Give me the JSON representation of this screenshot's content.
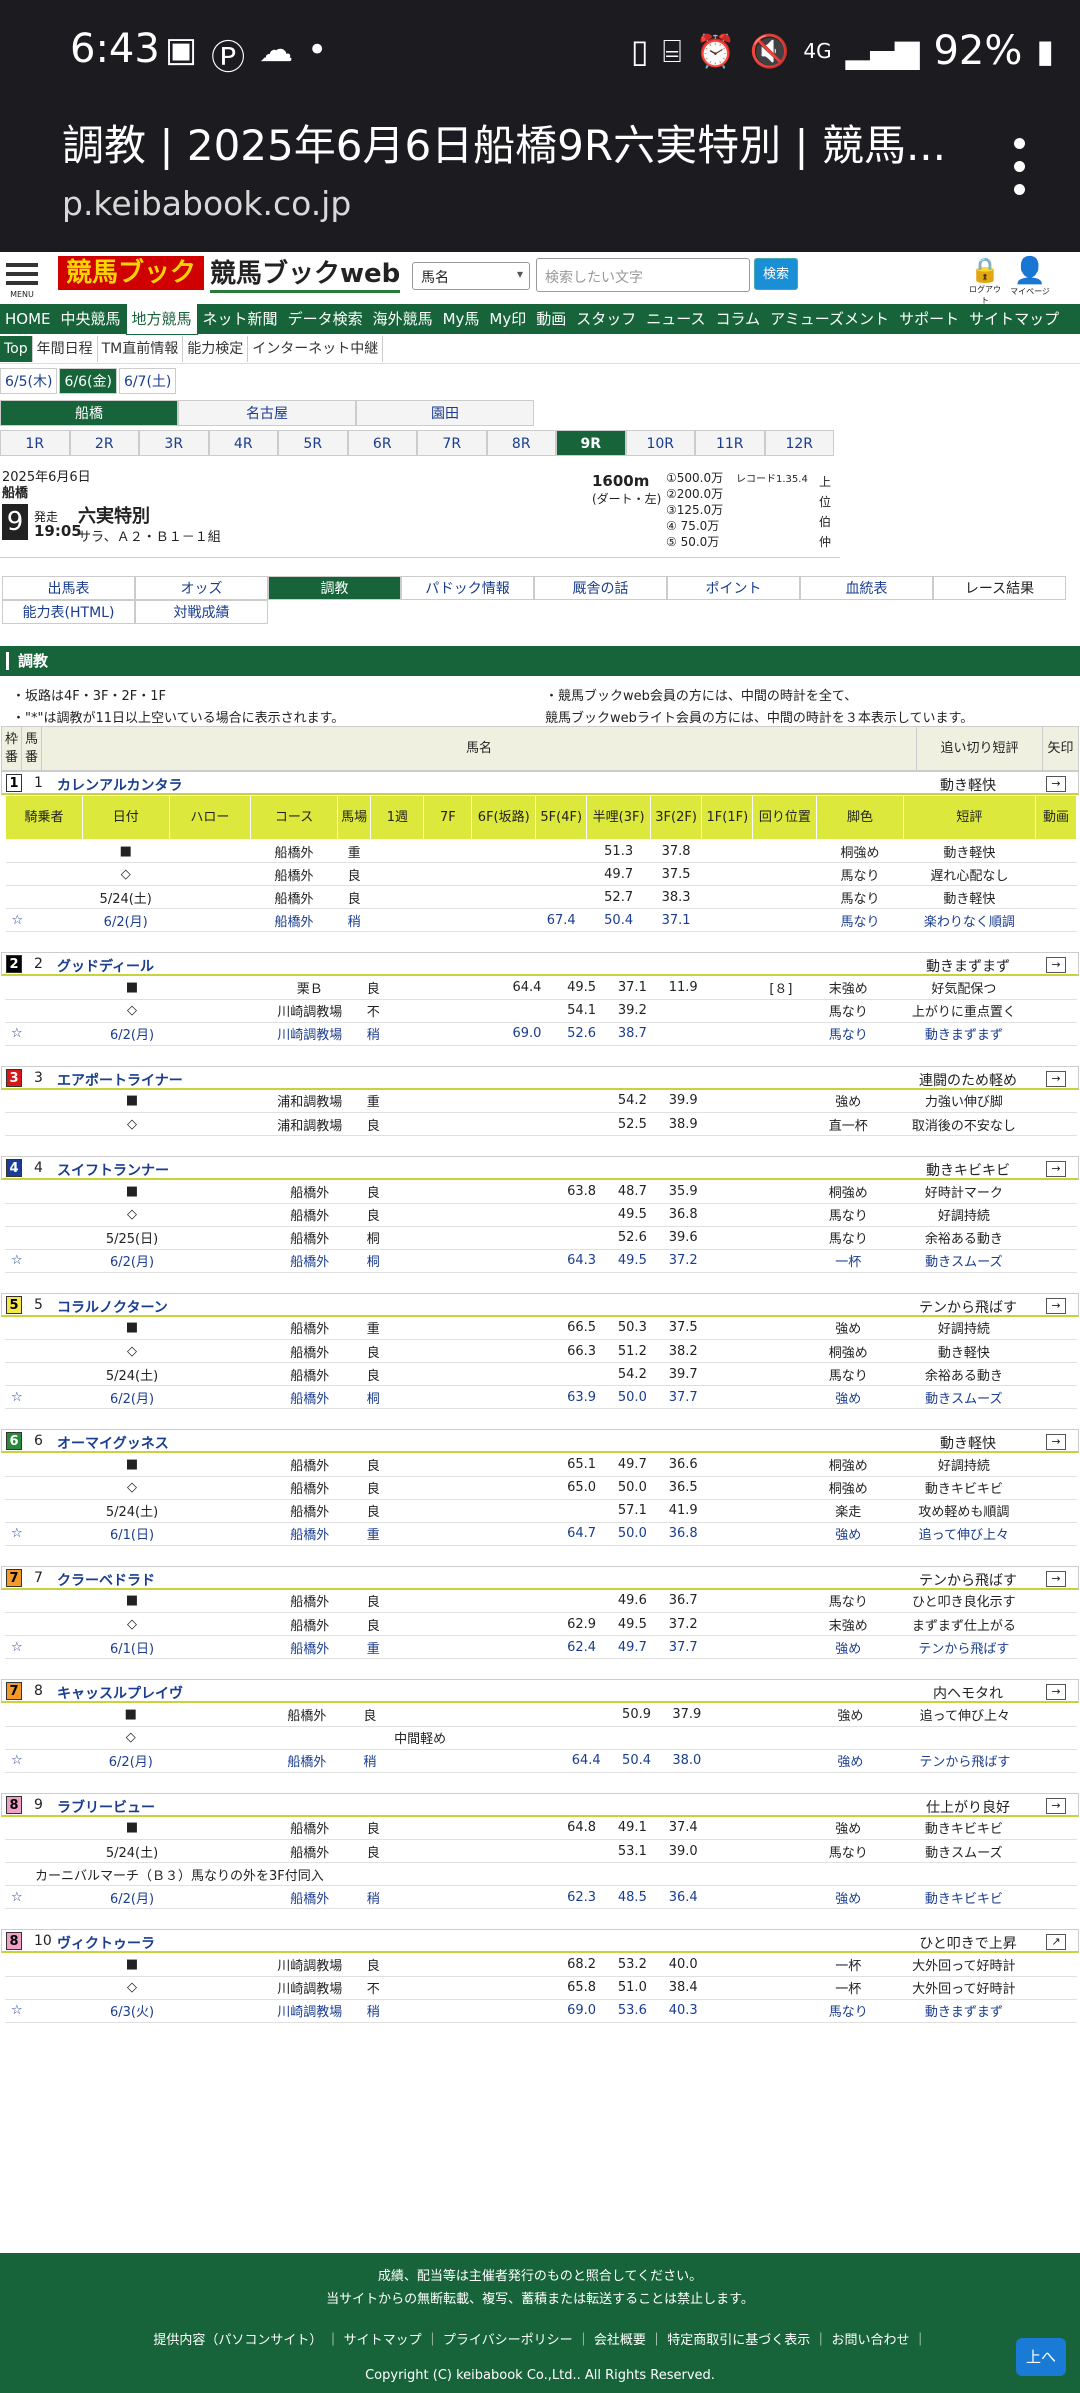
{
  "statusbar": {
    "time": "6:43",
    "battery": "92%",
    "network": "4G"
  },
  "browser": {
    "page_title": "調教 | 2025年6月6日船橋9R六実特別 | 競馬...",
    "url": "p.keibabook.co.jp"
  },
  "header": {
    "menu_label": "MENU",
    "logo_mark": "競馬ブック",
    "logo_text": "競馬ブックweb",
    "select_value": "馬名",
    "search_placeholder": "検索したい文字",
    "search_button": "検索",
    "logout_label": "ログアウト",
    "mypage_label": "マイページ"
  },
  "gnav": [
    "HOME",
    "中央競馬",
    "地方競馬",
    "ネット新聞",
    "データ検索",
    "海外競馬",
    "My馬",
    "My印",
    "動画",
    "スタッフ",
    "ニュース",
    "コラム",
    "アミューズメント",
    "サポート",
    "サイトマップ"
  ],
  "subnav": [
    "Top",
    "年間日程",
    "TM直前情報",
    "能力検定",
    "インターネット中継"
  ],
  "dates": [
    "6/5(木)",
    "6/6(金)",
    "6/7(土)"
  ],
  "venues": [
    "船橋",
    "名古屋",
    "園田"
  ],
  "races": [
    "1R",
    "2R",
    "3R",
    "4R",
    "5R",
    "6R",
    "7R",
    "8R",
    "9R",
    "10R",
    "11R",
    "12R"
  ],
  "race": {
    "date": "2025年6月6日",
    "venue": "船橋",
    "number": "9",
    "start_label": "発走",
    "start_time": "19:05",
    "name": "六実特別",
    "conditions": "サラ、Ａ２・Ｂ１－１組",
    "distance": "1600m",
    "track": "(ダート・左)",
    "record": "レコード1.35.4",
    "prizes": [
      "①500.0万",
      "②200.0万",
      "③125.0万",
      "④ 75.0万",
      "⑤ 50.0万"
    ],
    "tier": [
      "上",
      "位",
      "伯",
      "仲"
    ]
  },
  "tabs": [
    "出馬表",
    "オッズ",
    "調教",
    "パドック情報",
    "厩舎の話",
    "ポイント",
    "血統表",
    "レース結果",
    "能力表(HTML)",
    "対戦成績"
  ],
  "section_title": "調教",
  "notes_left": [
    "・坂路は4F・3F・2F・1F",
    "・\"*\"は調教が11日以上空いている場合に表示されます。"
  ],
  "notes_right": [
    "・競馬ブックweb会員の方には、中間の時計を全て、",
    "競馬ブックwebライト会員の方には、中間の時計を３本表示しています。"
  ],
  "page_header": {
    "waku": "枠番",
    "uma": "馬番",
    "name": "馬名",
    "short": "追い切り短評",
    "arrow": "矢印"
  },
  "train_header": [
    "騎乗者",
    "日付",
    "ハロー",
    "コース",
    "馬場",
    "1週",
    "7F",
    "6F(坂路)",
    "5F(4F)",
    "半哩(3F)",
    "3F(2F)",
    "1F(1F)",
    "回り位置",
    "脚色",
    "短評",
    "動画"
  ],
  "horses": [
    {
      "waku": "1",
      "uma": "1",
      "name": "カレンアルカンタラ",
      "short": "動き軽快",
      "color": "#ffffff",
      "rows": [
        [
          "",
          "■",
          "",
          "船橋外",
          "重",
          "",
          "",
          "",
          "",
          "51.3",
          "37.8",
          "",
          "",
          "桐強め",
          "動き軽快",
          ""
        ],
        [
          "",
          "◇",
          "",
          "船橋外",
          "良",
          "",
          "",
          "",
          "",
          "49.7",
          "37.5",
          "",
          "",
          "馬なり",
          "遅れ心配なし",
          ""
        ],
        [
          "",
          "5/24(土)",
          "",
          "船橋外",
          "良",
          "",
          "",
          "",
          "",
          "52.7",
          "38.3",
          "",
          "",
          "馬なり",
          "動き軽快",
          ""
        ],
        [
          "☆",
          "6/2(月)",
          "",
          "船橋外",
          "稍",
          "",
          "",
          "",
          "67.4",
          "50.4",
          "37.1",
          "",
          "",
          "馬なり",
          "楽わりなく順調",
          ""
        ]
      ]
    },
    {
      "waku": "2",
      "uma": "2",
      "name": "グッドディール",
      "short": "動きまずまず",
      "color": "#000000",
      "rows": [
        [
          "",
          "■",
          "",
          "栗Ｂ",
          "良",
          "",
          "",
          "64.4",
          "49.5",
          "37.1",
          "11.9",
          "",
          "[８]",
          "末強め",
          "好気配保つ",
          ""
        ],
        [
          "",
          "◇",
          "",
          "川崎調教場",
          "不",
          "",
          "",
          "",
          "54.1",
          "39.2",
          "",
          "",
          "",
          "馬なり",
          "上がりに重点置く",
          ""
        ],
        [
          "☆",
          "6/2(月)",
          "",
          "川崎調教場",
          "稍",
          "",
          "",
          "69.0",
          "52.6",
          "38.7",
          "",
          "",
          "",
          "馬なり",
          "動きまずまず",
          ""
        ]
      ]
    },
    {
      "waku": "3",
      "uma": "3",
      "name": "エアポートライナー",
      "short": "連闘のため軽め",
      "color": "#d81818",
      "rows": [
        [
          "",
          "■",
          "",
          "浦和調教場",
          "重",
          "",
          "",
          "",
          "",
          "54.2",
          "39.9",
          "",
          "",
          "強め",
          "力強い伸び脚",
          ""
        ],
        [
          "",
          "◇",
          "",
          "浦和調教場",
          "良",
          "",
          "",
          "",
          "",
          "52.5",
          "38.9",
          "",
          "",
          "直一杯",
          "取消後の不安なし",
          ""
        ]
      ]
    },
    {
      "waku": "4",
      "uma": "4",
      "name": "スイフトランナー",
      "short": "動きキビキビ",
      "color": "#1a3d9a",
      "rows": [
        [
          "",
          "■",
          "",
          "船橋外",
          "良",
          "",
          "",
          "",
          "63.8",
          "48.7",
          "35.9",
          "",
          "",
          "桐強め",
          "好時計マーク",
          ""
        ],
        [
          "",
          "◇",
          "",
          "船橋外",
          "良",
          "",
          "",
          "",
          "",
          "49.5",
          "36.8",
          "",
          "",
          "馬なり",
          "好調持続",
          ""
        ],
        [
          "",
          "5/25(日)",
          "",
          "船橋外",
          "桐",
          "",
          "",
          "",
          "",
          "52.6",
          "39.6",
          "",
          "",
          "馬なり",
          "余裕ある動き",
          ""
        ],
        [
          "☆",
          "6/2(月)",
          "",
          "船橋外",
          "桐",
          "",
          "",
          "",
          "64.3",
          "49.5",
          "37.2",
          "",
          "",
          "一杯",
          "動きスムーズ",
          ""
        ]
      ]
    },
    {
      "waku": "5",
      "uma": "5",
      "name": "コラルノクターン",
      "short": "テンから飛ばす",
      "color": "#f6e84a",
      "rows": [
        [
          "",
          "■",
          "",
          "船橋外",
          "重",
          "",
          "",
          "",
          "66.5",
          "50.3",
          "37.5",
          "",
          "",
          "強め",
          "好調持続",
          ""
        ],
        [
          "",
          "◇",
          "",
          "船橋外",
          "良",
          "",
          "",
          "",
          "66.3",
          "51.2",
          "38.2",
          "",
          "",
          "桐強め",
          "動き軽快",
          ""
        ],
        [
          "",
          "5/24(土)",
          "",
          "船橋外",
          "良",
          "",
          "",
          "",
          "",
          "54.2",
          "39.7",
          "",
          "",
          "馬なり",
          "余裕ある動き",
          ""
        ],
        [
          "☆",
          "6/2(月)",
          "",
          "船橋外",
          "桐",
          "",
          "",
          "",
          "63.9",
          "50.0",
          "37.7",
          "",
          "",
          "強め",
          "動きスムーズ",
          ""
        ]
      ]
    },
    {
      "waku": "6",
      "uma": "6",
      "name": "オーマイグッネス",
      "short": "動き軽快",
      "color": "#2a8a3a",
      "rows": [
        [
          "",
          "■",
          "",
          "船橋外",
          "良",
          "",
          "",
          "",
          "65.1",
          "49.7",
          "36.6",
          "",
          "",
          "桐強め",
          "好調持続",
          ""
        ],
        [
          "",
          "◇",
          "",
          "船橋外",
          "良",
          "",
          "",
          "",
          "65.0",
          "50.0",
          "36.5",
          "",
          "",
          "桐強め",
          "動きキビキビ",
          ""
        ],
        [
          "",
          "5/24(土)",
          "",
          "船橋外",
          "良",
          "",
          "",
          "",
          "",
          "57.1",
          "41.9",
          "",
          "",
          "楽走",
          "攻め軽めも順調",
          ""
        ],
        [
          "☆",
          "6/1(日)",
          "",
          "船橋外",
          "重",
          "",
          "",
          "",
          "64.7",
          "50.0",
          "36.8",
          "",
          "",
          "強め",
          "追って伸び上々",
          ""
        ]
      ]
    },
    {
      "waku": "7",
      "uma": "7",
      "name": "クラーベドラド",
      "short": "テンから飛ばす",
      "color": "#f39a2a",
      "rows": [
        [
          "",
          "■",
          "",
          "船橋外",
          "良",
          "",
          "",
          "",
          "",
          "49.6",
          "36.7",
          "",
          "",
          "馬なり",
          "ひと叩き良化示す",
          ""
        ],
        [
          "",
          "◇",
          "",
          "船橋外",
          "良",
          "",
          "",
          "",
          "62.9",
          "49.5",
          "37.2",
          "",
          "",
          "末強め",
          "まずまず仕上がる",
          ""
        ],
        [
          "☆",
          "6/1(日)",
          "",
          "船橋外",
          "重",
          "",
          "",
          "",
          "62.4",
          "49.7",
          "37.7",
          "",
          "",
          "強め",
          "テンから飛ばす",
          ""
        ]
      ]
    },
    {
      "waku": "7",
      "uma": "8",
      "name": "キャッスルプレイヴ",
      "short": "内ヘモタれ",
      "color": "#f39a2a",
      "rows": [
        [
          "",
          "■",
          "",
          "船橋外",
          "良",
          "",
          "",
          "",
          "",
          "50.9",
          "37.9",
          "",
          "",
          "強め",
          "追って伸び上々",
          ""
        ],
        [
          "",
          "◇",
          "",
          "",
          "",
          "中間軽め",
          "",
          "",
          "",
          "",
          "",
          "",
          "",
          "",
          "",
          ""
        ],
        [
          "☆",
          "6/2(月)",
          "",
          "船橋外",
          "稍",
          "",
          "",
          "",
          "64.4",
          "50.4",
          "38.0",
          "",
          "",
          "強め",
          "テンから飛ばす",
          ""
        ]
      ]
    },
    {
      "waku": "8",
      "uma": "9",
      "name": "ラブリービュー",
      "short": "仕上がり良好",
      "color": "#f0a0c8",
      "rows": [
        [
          "",
          "■",
          "",
          "船橋外",
          "良",
          "",
          "",
          "",
          "64.8",
          "49.1",
          "37.4",
          "",
          "",
          "強め",
          "動きキビキビ",
          ""
        ],
        [
          "",
          "5/24(土)",
          "",
          "船橋外",
          "良",
          "",
          "",
          "",
          "",
          "53.1",
          "39.0",
          "",
          "",
          "馬なり",
          "動きスムーズ",
          ""
        ],
        [
          "note",
          "カーニバルマーチ（Ｂ３）馬なりの外を3F付同入"
        ],
        [
          "☆",
          "6/2(月)",
          "",
          "船橋外",
          "稍",
          "",
          "",
          "",
          "62.3",
          "48.5",
          "36.4",
          "",
          "",
          "強め",
          "動きキビキビ",
          ""
        ]
      ]
    },
    {
      "waku": "8",
      "uma": "10",
      "name": "ヴィクトゥーラ",
      "short": "ひと叩きで上昇",
      "color": "#f0a0c8",
      "rows": [
        [
          "",
          "■",
          "",
          "川崎調教場",
          "良",
          "",
          "",
          "",
          "68.2",
          "53.2",
          "40.0",
          "",
          "",
          "一杯",
          "大外回って好時計",
          ""
        ],
        [
          "",
          "◇",
          "",
          "川崎調教場",
          "不",
          "",
          "",
          "",
          "65.8",
          "51.0",
          "38.4",
          "",
          "",
          "一杯",
          "大外回って好時計",
          ""
        ],
        [
          "☆",
          "6/3(火)",
          "",
          "川崎調教場",
          "稍",
          "",
          "",
          "",
          "69.0",
          "53.6",
          "40.3",
          "",
          "",
          "馬なり",
          "動きまずまず",
          ""
        ]
      ]
    }
  ],
  "footer": {
    "line1": "成績、配当等は主催者発行のものと照合してください。",
    "line2": "当サイトからの無断転載、複写、蓄積または転送することは禁止します。",
    "links": "提供内容（パソコンサイト） ｜ サイトマップ ｜ プライバシーポリシー ｜ 会社概要 ｜ 特定商取引に基づく表示 ｜ お問い合わせ ｜",
    "copyright": "Copyright (C) keibabook Co.,Ltd.. All Rights Reserved.",
    "up_button": "上へ"
  }
}
